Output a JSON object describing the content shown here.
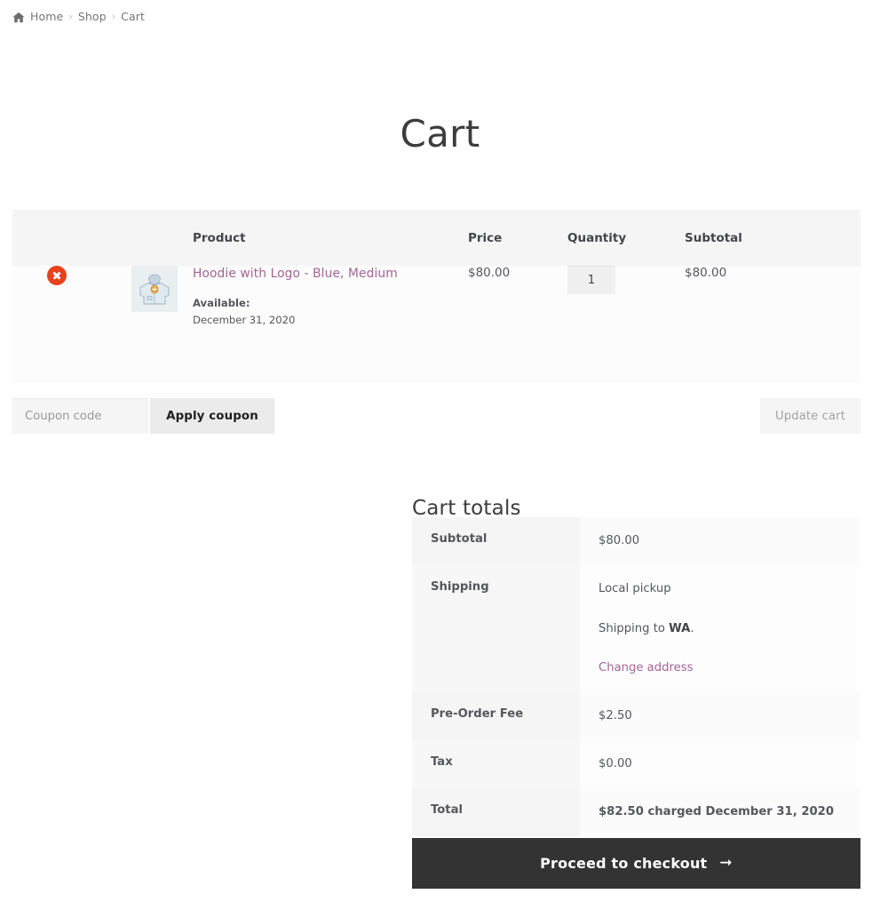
{
  "breadcrumb": {
    "home_icon": "home-icon",
    "items": [
      "Home",
      "Shop",
      "Cart"
    ],
    "separator": "›"
  },
  "page": {
    "title": "Cart"
  },
  "cart_table": {
    "headers": [
      "",
      "",
      "Product",
      "Price",
      "Quantity",
      "Subtotal"
    ],
    "rows": [
      {
        "remove_icon": "remove-circle-icon",
        "thumbnail_icon": "hoodie-thumbnail",
        "product_name": "Hoodie with Logo - Blue, Medium",
        "meta_label": "Available:",
        "meta_value": "December 31, 2020",
        "price": "$80.00",
        "quantity": "1",
        "subtotal": "$80.00"
      }
    ]
  },
  "actions": {
    "coupon_placeholder": "Coupon code",
    "coupon_value": "",
    "apply_coupon_label": "Apply coupon",
    "update_cart_label": "Update cart"
  },
  "totals": {
    "heading": "Cart totals",
    "subtotal_label": "Subtotal",
    "subtotal_value": "$80.00",
    "shipping_label": "Shipping",
    "shipping_method": "Local pickup",
    "shipping_to_prefix": "Shipping to ",
    "shipping_to_region": "WA",
    "shipping_to_suffix": ".",
    "change_address_label": "Change address",
    "preorder_fee_label": "Pre-Order Fee",
    "preorder_fee_value": "$2.50",
    "tax_label": "Tax",
    "tax_value": "$0.00",
    "total_label": "Total",
    "total_value": "$82.50 charged December 31, 2020"
  },
  "checkout": {
    "label": "Proceed to checkout",
    "arrow": "➞"
  },
  "colors": {
    "link": "#a46497",
    "remove": "#e8411b",
    "checkout_bg": "#333333",
    "header_bg": "#f5f5f5",
    "thumb_bg": "#e9eef1"
  }
}
